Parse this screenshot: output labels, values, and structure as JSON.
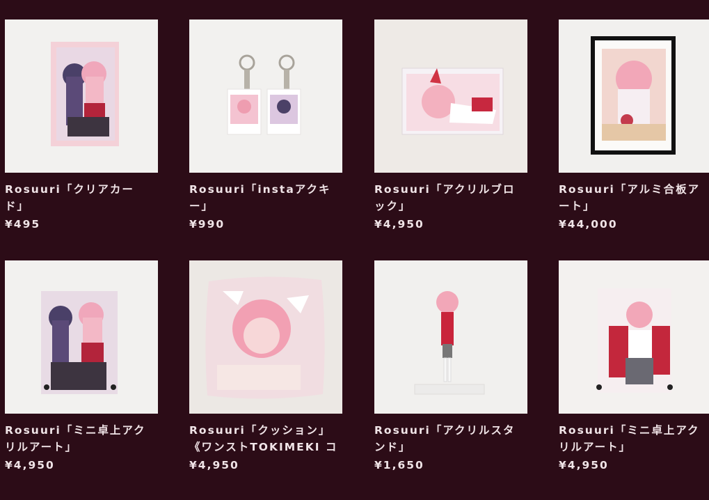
{
  "products": [
    {
      "line1": "Rosuuri「クリアカー",
      "line2": "ド」",
      "price": "¥495",
      "icon": "clear-card-product-image"
    },
    {
      "line1": "Rosuuri「instaアクキ",
      "line2": "ー」",
      "price": "¥990",
      "icon": "acrylic-keychain-product-image"
    },
    {
      "line1": "Rosuuri「アクリルブロ",
      "line2": "ック」",
      "price": "¥4,950",
      "icon": "acrylic-block-product-image"
    },
    {
      "line1": "Rosuuri「アルミ合板ア",
      "line2": "ート」",
      "price": "¥44,000",
      "icon": "aluminum-art-product-image"
    },
    {
      "line1": "Rosuuri「ミニ卓上アク",
      "line2": "リルアート」",
      "price": "¥4,950",
      "icon": "mini-acrylic-art-product-image"
    },
    {
      "line1": "Rosuuri「クッション」",
      "line2": "《ワンストTOKIMEKI コ",
      "price": "¥4,950",
      "icon": "cushion-product-image"
    },
    {
      "line1": "Rosuuri「アクリルスタ",
      "line2": "ンド」",
      "price": "¥1,650",
      "icon": "acrylic-stand-product-image"
    },
    {
      "line1": "Rosuuri「ミニ卓上アク",
      "line2": "リルアート」",
      "price": "¥4,950",
      "icon": "mini-acrylic-art-product-image"
    }
  ]
}
